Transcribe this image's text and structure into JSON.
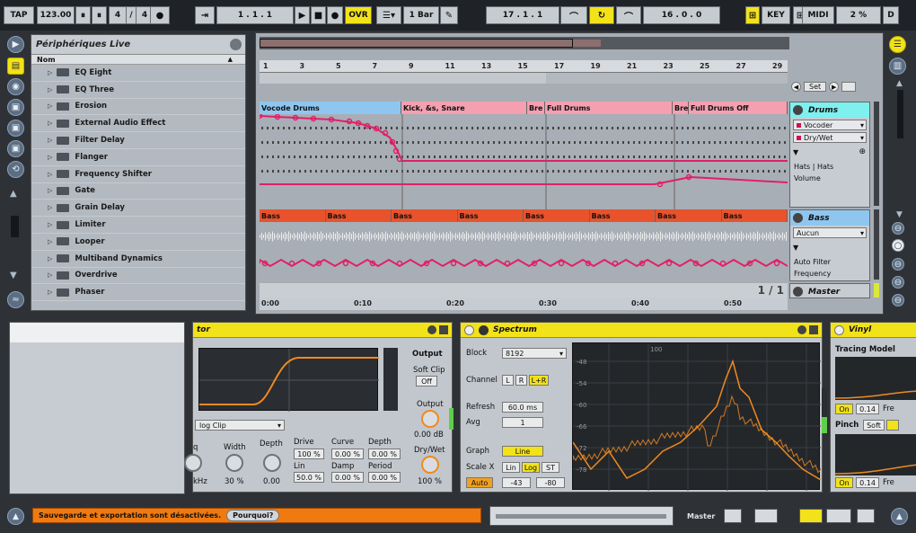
{
  "topbar": {
    "tap": "TAP",
    "tempo": "123.00",
    "signature_num": "4",
    "signature_sep": "/",
    "signature_den": "4",
    "position": "1 .   1 .   1",
    "ovr": "OVR",
    "quantize": "1 Bar",
    "loop_start": "17 .   1 .   1",
    "loop_length": "16 .   0 .   0",
    "key": "KEY",
    "midi": "MIDI",
    "cpu": "2 %",
    "d": "D"
  },
  "browser": {
    "title": "Périphériques Live",
    "column_name": "Nom",
    "items": [
      "EQ Eight",
      "EQ Three",
      "Erosion",
      "External Audio Effect",
      "Filter Delay",
      "Flanger",
      "Frequency Shifter",
      "Gate",
      "Grain Delay",
      "Limiter",
      "Looper",
      "Multiband Dynamics",
      "Overdrive",
      "Phaser"
    ]
  },
  "arrangement": {
    "bars": [
      "1",
      "3",
      "5",
      "7",
      "9",
      "11",
      "13",
      "15",
      "17",
      "19",
      "21",
      "23",
      "25",
      "27",
      "29"
    ],
    "times": [
      "0:00",
      "0:10",
      "0:20",
      "0:30",
      "0:40",
      "0:50"
    ],
    "set_label": "Set",
    "drums_clips": [
      "Vocode Drums",
      "Kick, &s, Snare",
      "Bre",
      "Full Drums",
      "Bre",
      "Full Drums Off"
    ],
    "bass_clips": [
      "Bass",
      "Bass",
      "Bass",
      "Bass",
      "Bass",
      "Bass",
      "Bass",
      "Bass"
    ],
    "page": "1 / 1",
    "drums_track": {
      "name": "Drums",
      "device": "Vocoder",
      "param": "Dry/Wet",
      "sub1": "Hats | Hats",
      "sub2": "Volume"
    },
    "bass_track": {
      "name": "Bass",
      "device": "Aucun",
      "sub1": "Auto Filter",
      "sub2": "Frequency"
    },
    "master_track": {
      "name": "Master"
    }
  },
  "saturator": {
    "title": "tor",
    "mode": "log Clip",
    "output_label": "Output",
    "softclip_label": "Soft Clip",
    "softclip_value": "Off",
    "output_knob_label": "Output",
    "output_value": "0.00 dB",
    "drywet_label": "Dry/Wet",
    "drywet_value": "100 %",
    "q_label": "q",
    "width_label": "Width",
    "width_value": "30 %",
    "depth_label": "Depth",
    "depth_value": "0.00",
    "khz_value": "kHz",
    "drive_label": "Drive",
    "drive_value": "100 %",
    "lin_label": "Lin",
    "lin_value": "50.0 %",
    "curve_label": "Curve",
    "curve_value": "0.00 %",
    "damp_label": "Damp",
    "damp_value": "0.00 %",
    "depth2_label": "Depth",
    "depth2_value": "0.00 %",
    "period_label": "Period",
    "period_value": "0.00 %"
  },
  "spectrum": {
    "title": "Spectrum",
    "block_label": "Block",
    "block_value": "8192",
    "channel_label": "Channel",
    "ch_l": "L",
    "ch_r": "R",
    "ch_lr": "L+R",
    "refresh_label": "Refresh",
    "refresh_value": "60.0 ms",
    "avg_label": "Avg",
    "avg_value": "1",
    "graph_label": "Graph",
    "graph_value": "Line",
    "scalex_label": "Scale X",
    "scale_lin": "Lin",
    "scale_log": "Log",
    "scale_st": "ST",
    "auto_label": "Auto",
    "range_low": "-43",
    "range_high": "-80",
    "freq_label": "100",
    "db_labels": [
      "-48",
      "-54",
      "-60",
      "-66",
      "-72",
      "-78"
    ]
  },
  "vinyl": {
    "title": "Vinyl",
    "tracing": "Tracing Model",
    "on1": "On",
    "v1": "0.14",
    "freq1": "Fre",
    "pinch": "Pinch",
    "soft": "Soft",
    "on2": "On",
    "v2": "0.14",
    "freq2": "Fre"
  },
  "status": {
    "message": "Sauvegarde et exportation sont désactivées.",
    "why": "Pourquoi?",
    "master_label": "Master"
  },
  "colors": {
    "drums_clip": "#8fc6f0",
    "drums_clip2": "#f4a0b0",
    "bass_clip": "#e8532c",
    "automation": "#e0206a",
    "accent": "#f2e21a",
    "spectrum_line": "#f08a20"
  }
}
